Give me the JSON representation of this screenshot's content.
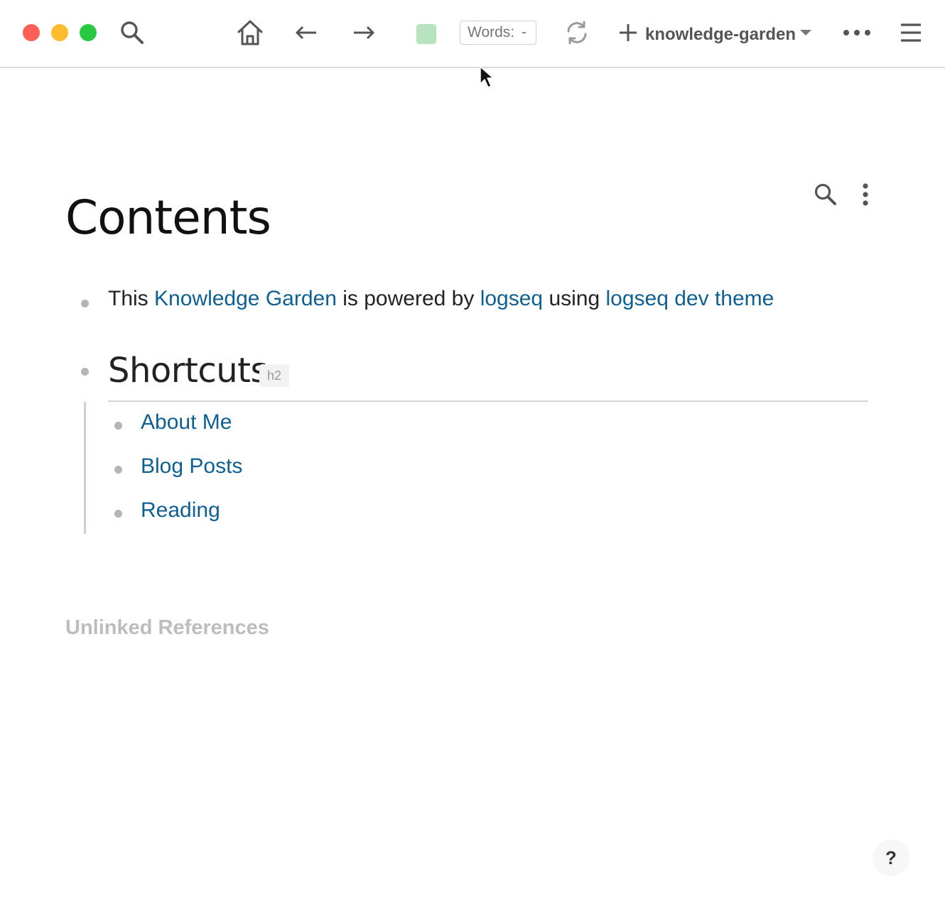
{
  "toolbar": {
    "words_label": "Words:",
    "words_value": "-",
    "graph_name": "knowledge-garden"
  },
  "page": {
    "title": "Contents",
    "blocks": {
      "intro": {
        "prefix": "This",
        "link1": "Knowledge Garden",
        "mid1": "is powered by",
        "link2": "logseq",
        "mid2": "using",
        "link3": "logseq dev theme"
      },
      "heading": {
        "text": "Shortcuts",
        "tag": "h2",
        "children": [
          "About Me",
          "Blog Posts",
          "Reading"
        ]
      }
    },
    "unlinked_references_label": "Unlinked References"
  },
  "help": {
    "label": "?"
  },
  "colors": {
    "link": "#0f5f92",
    "traffic_red": "#fe5f57",
    "traffic_yellow": "#febc2e",
    "traffic_green": "#28c840",
    "sync_indicator": "#b7e3bf"
  },
  "icons": [
    "search-icon",
    "home-icon",
    "arrow-left-icon",
    "arrow-right-icon",
    "refresh-icon",
    "plus-icon",
    "more-horizontal-icon",
    "hamburger-menu-icon",
    "search-icon",
    "more-vertical-icon",
    "mouse-cursor-icon"
  ]
}
